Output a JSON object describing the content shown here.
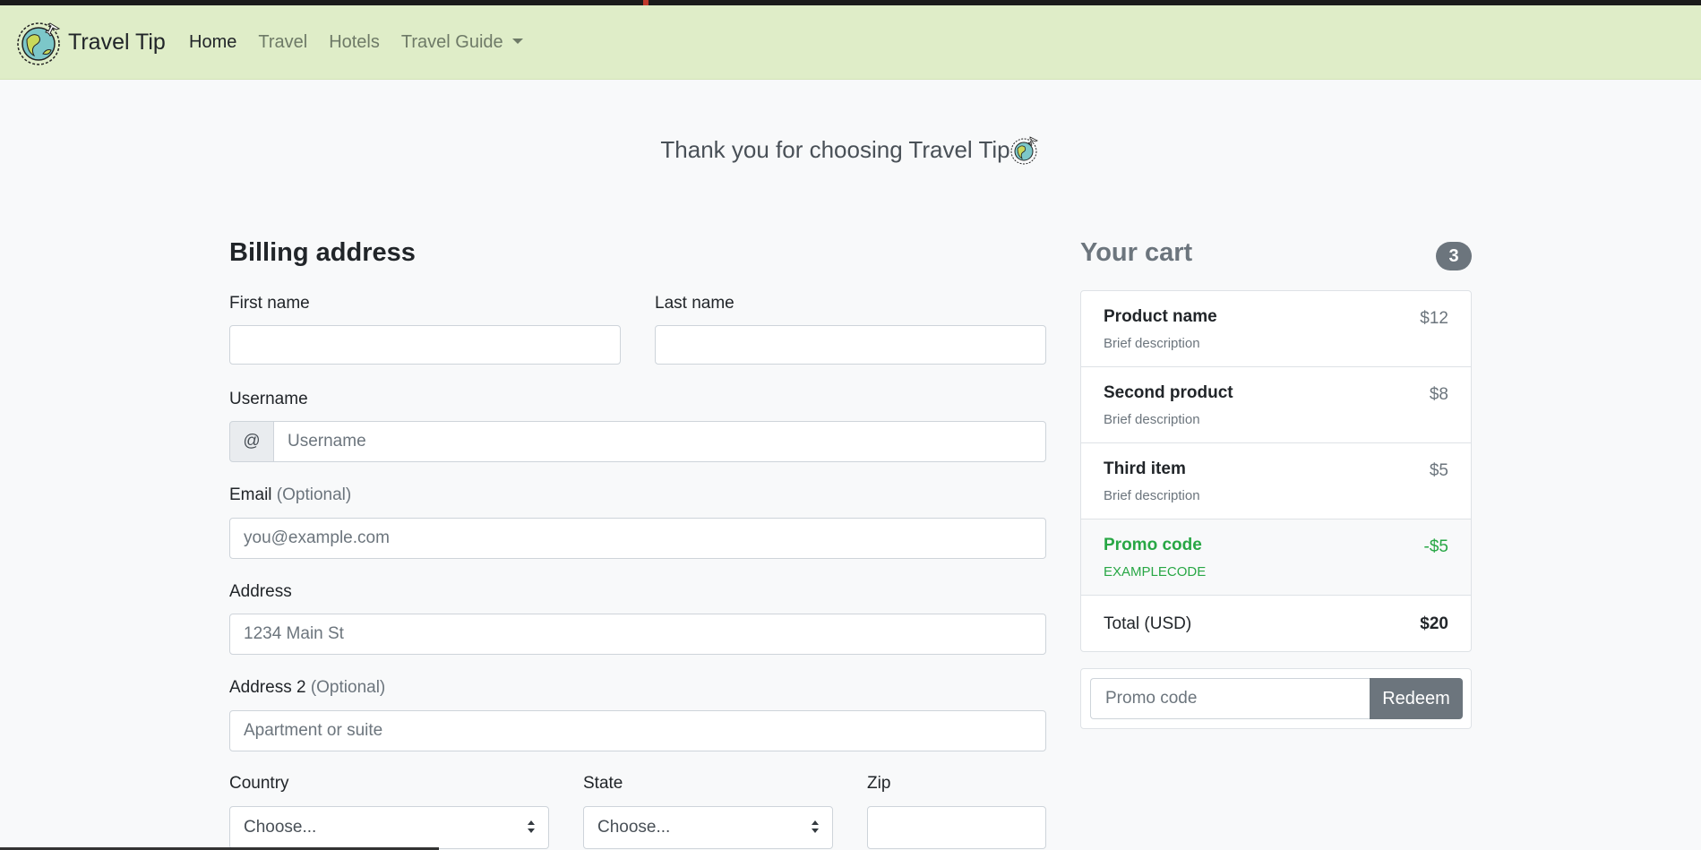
{
  "navbar": {
    "brand": "Travel Tip",
    "links": [
      "Home",
      "Travel",
      "Hotels",
      "Travel Guide"
    ]
  },
  "thanks": "Thank you for choosing Travel Tip",
  "billing": {
    "title": "Billing address",
    "first_name_label": "First name",
    "last_name_label": "Last name",
    "username_label": "Username",
    "username_addon": "@",
    "username_placeholder": "Username",
    "email_label": "Email",
    "email_optional": "(Optional)",
    "email_placeholder": "you@example.com",
    "address_label": "Address",
    "address_placeholder": "1234 Main St",
    "address2_label": "Address 2",
    "address2_optional": "(Optional)",
    "address2_placeholder": "Apartment or suite",
    "country_label": "Country",
    "country_value": "Choose...",
    "state_label": "State",
    "state_value": "Choose...",
    "zip_label": "Zip"
  },
  "cart": {
    "title": "Your cart",
    "count": "3",
    "items": [
      {
        "name": "Product name",
        "desc": "Brief description",
        "price": "$12"
      },
      {
        "name": "Second product",
        "desc": "Brief description",
        "price": "$8"
      },
      {
        "name": "Third item",
        "desc": "Brief description",
        "price": "$5"
      }
    ],
    "promo": {
      "name": "Promo code",
      "code": "EXAMPLECODE",
      "amount": "-$5"
    },
    "total_label": "Total (USD)",
    "total_value": "$20",
    "promo_placeholder": "Promo code",
    "redeem_label": "Redeem"
  },
  "colors": {
    "navbar": "#dfedc8",
    "success": "#28a745",
    "secondary": "#6c757d"
  }
}
